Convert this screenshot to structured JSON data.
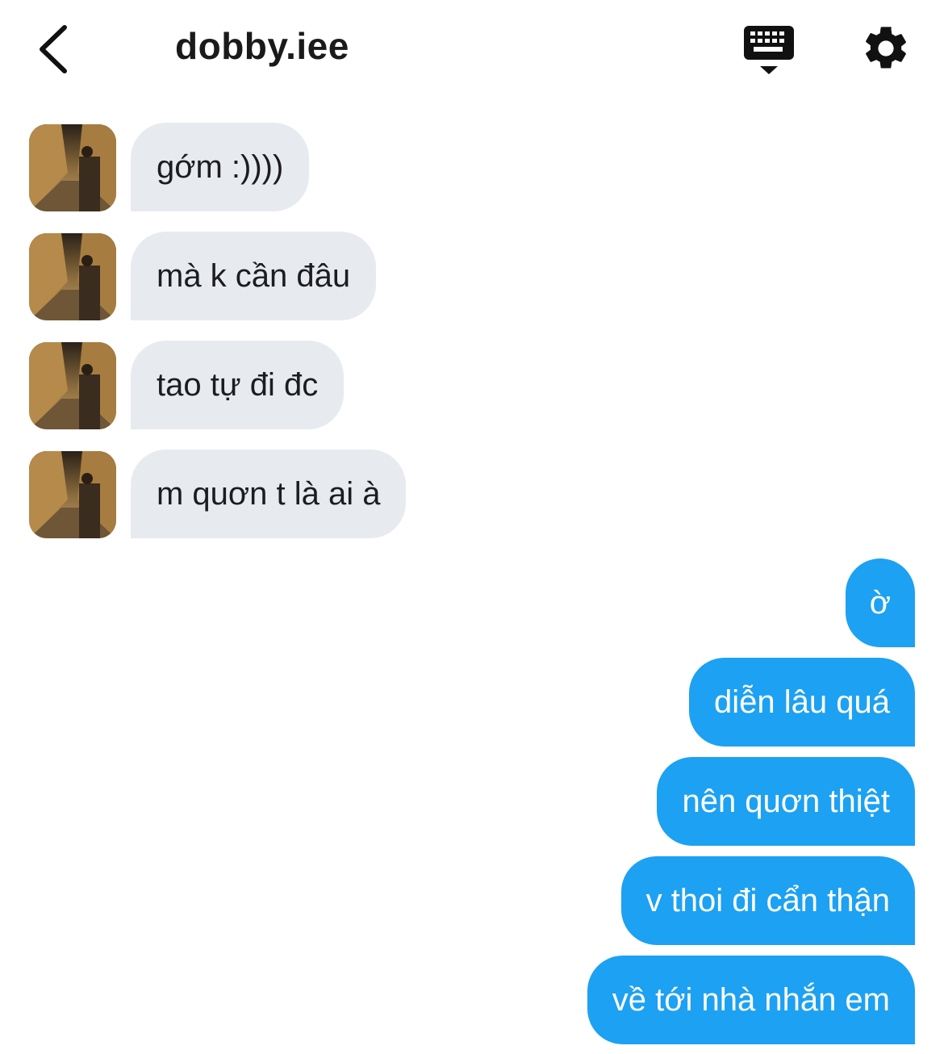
{
  "header": {
    "title": "dobby.iee",
    "back_icon": "chevron-left-icon",
    "keyboard_icon": "keyboard-icon",
    "settings_icon": "gear-icon"
  },
  "colors": {
    "incoming_bubble": "#e7ebf0",
    "outgoing_bubble": "#1da1f2",
    "incoming_text": "#1d1d1f",
    "outgoing_text": "#ffffff"
  },
  "messages": {
    "incoming": [
      {
        "text": "gớm :))))"
      },
      {
        "text": "mà k cần đâu"
      },
      {
        "text": "tao tự đi đc"
      },
      {
        "text": "m quơn t là ai à"
      }
    ],
    "outgoing": [
      {
        "text": "ờ"
      },
      {
        "text": "diễn lâu quá"
      },
      {
        "text": "nên quơn thiệt"
      },
      {
        "text": "v thoi đi cẩn thận"
      },
      {
        "text": "về tới nhà nhắn em"
      }
    ]
  }
}
